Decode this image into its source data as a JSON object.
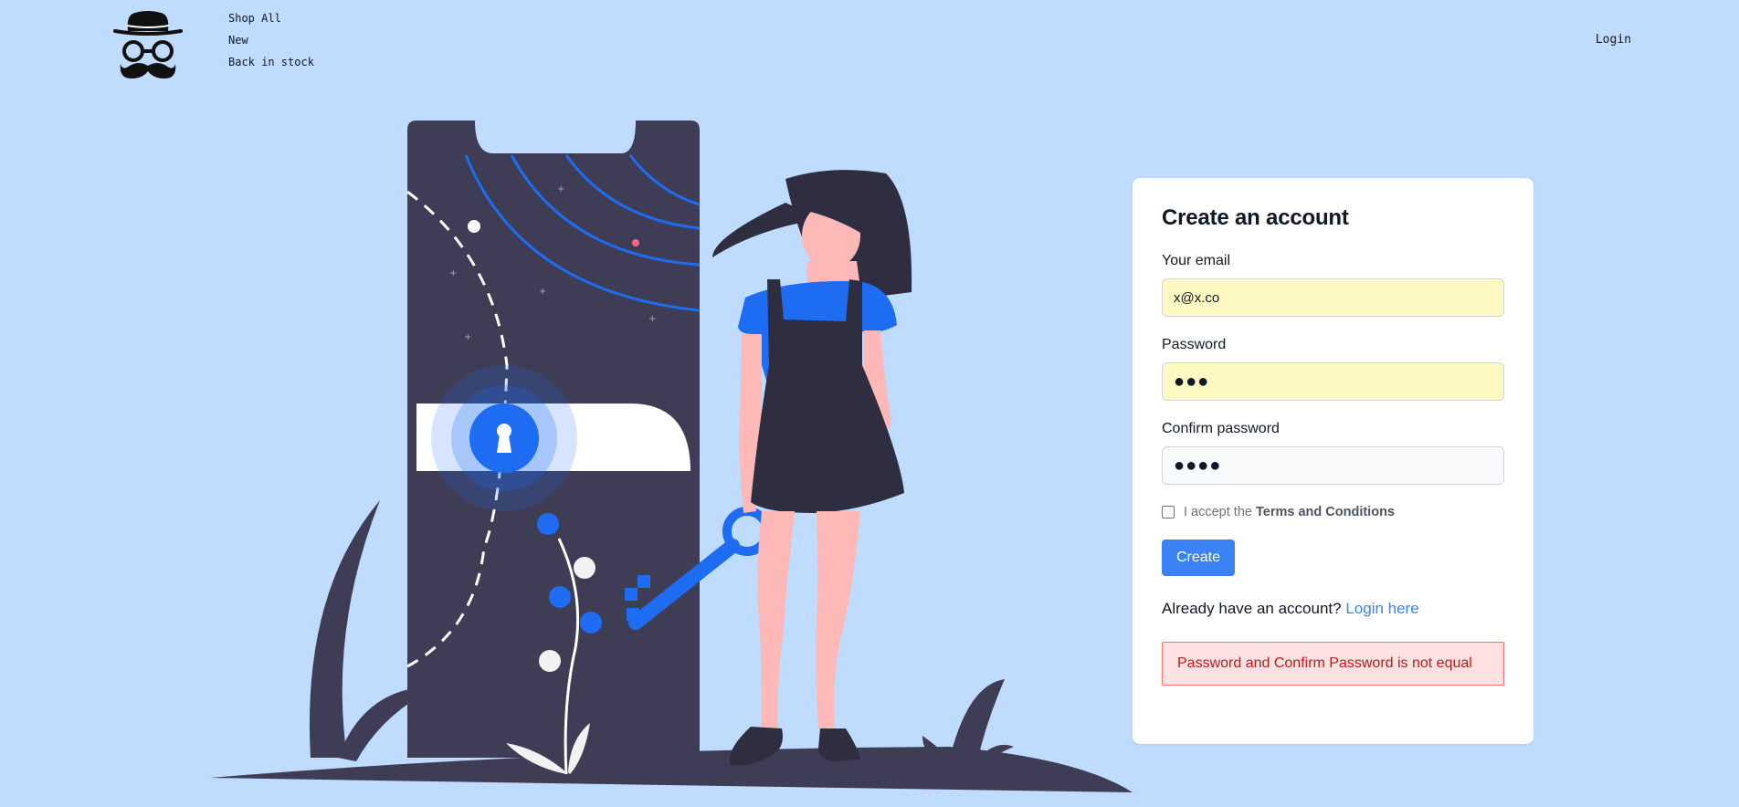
{
  "nav": {
    "items": [
      {
        "label": "Shop All"
      },
      {
        "label": "New"
      },
      {
        "label": "Back in stock"
      }
    ],
    "login_label": "Login"
  },
  "form": {
    "title": "Create an account",
    "email": {
      "label": "Your email",
      "value": "x@x.co"
    },
    "password": {
      "label": "Password",
      "value": "●●●"
    },
    "confirm_password": {
      "label": "Confirm password",
      "value": "●●●●"
    },
    "terms": {
      "prefix": "I accept the",
      "link_text": "Terms and Conditions",
      "checked": false
    },
    "create_label": "Create",
    "account_prompt": "Already have an account?",
    "login_here_label": "Login here",
    "error_message": "Password and Confirm Password is not equal"
  },
  "colors": {
    "background": "#bfdbfe",
    "accent": "#3b82f6",
    "phone": "#3f3d56",
    "error_bg": "#fee2e2",
    "error_text": "#b91c1c"
  },
  "icons": {
    "logo": "hat-glasses-mustache-icon",
    "lock": "keyhole-icon",
    "key": "key-icon"
  }
}
